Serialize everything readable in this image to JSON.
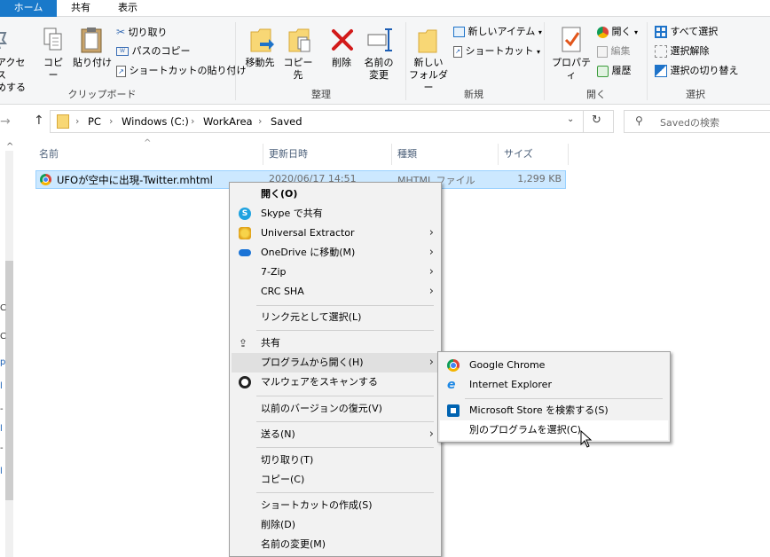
{
  "tabs": {
    "home": "ホーム",
    "share": "共有",
    "view": "表示"
  },
  "ribbon": {
    "access_l1": "アクセス",
    "access_l2": "めする",
    "copy": "コピー",
    "paste": "貼り付け",
    "cut": "切り取り",
    "copy_path": "パスのコピー",
    "paste_shortcut": "ショートカットの貼り付け",
    "group_clipboard": "クリップボード",
    "move_to": "移動先",
    "copy_to": "コピー先",
    "delete": "削除",
    "rename_l1": "名前の",
    "rename_l2": "変更",
    "group_organize": "整理",
    "new_folder_l1": "新しい",
    "new_folder_l2": "フォルダー",
    "new_item": "新しいアイテム",
    "shortcut": "ショートカット",
    "group_new": "新規",
    "properties": "プロパティ",
    "open": "開く",
    "edit": "編集",
    "history": "履歴",
    "group_open": "開く",
    "select_all": "すべて選択",
    "select_none": "選択解除",
    "invert_selection": "選択の切り替え",
    "group_select": "選択"
  },
  "address": {
    "crumbs": [
      "PC",
      "Windows (C:)",
      "WorkArea",
      "Saved"
    ],
    "search_placeholder": "Savedの検索"
  },
  "columns": {
    "name": "名前",
    "date": "更新日時",
    "type": "種類",
    "size": "サイズ"
  },
  "file": {
    "name": "UFOが空中に出現-Twitter.mhtml",
    "date": "2020/06/17 14:51",
    "type": "MHTML ファイル",
    "size": "1,299 KB"
  },
  "context_menu": {
    "open": "開く(O)",
    "skype": "Skype で共有",
    "universal_extractor": "Universal Extractor",
    "onedrive": "OneDrive に移動(M)",
    "zip": "7-Zip",
    "crc": "CRC SHA",
    "select_link": "リンク元として選択(L)",
    "share": "共有",
    "open_with": "プログラムから開く(H)",
    "malware": "マルウェアをスキャンする",
    "restore": "以前のバージョンの復元(V)",
    "send_to": "送る(N)",
    "cut": "切り取り(T)",
    "copy": "コピー(C)",
    "create_shortcut": "ショートカットの作成(S)",
    "delete": "削除(D)",
    "rename": "名前の変更(M)"
  },
  "submenu": {
    "chrome": "Google Chrome",
    "ie": "Internet Explorer",
    "store": "Microsoft Store を検索する(S)",
    "choose": "別のプログラムを選択(C)"
  },
  "nav_edge": [
    "C",
    "C",
    "p",
    "l",
    "-",
    "l",
    "-",
    "l"
  ]
}
